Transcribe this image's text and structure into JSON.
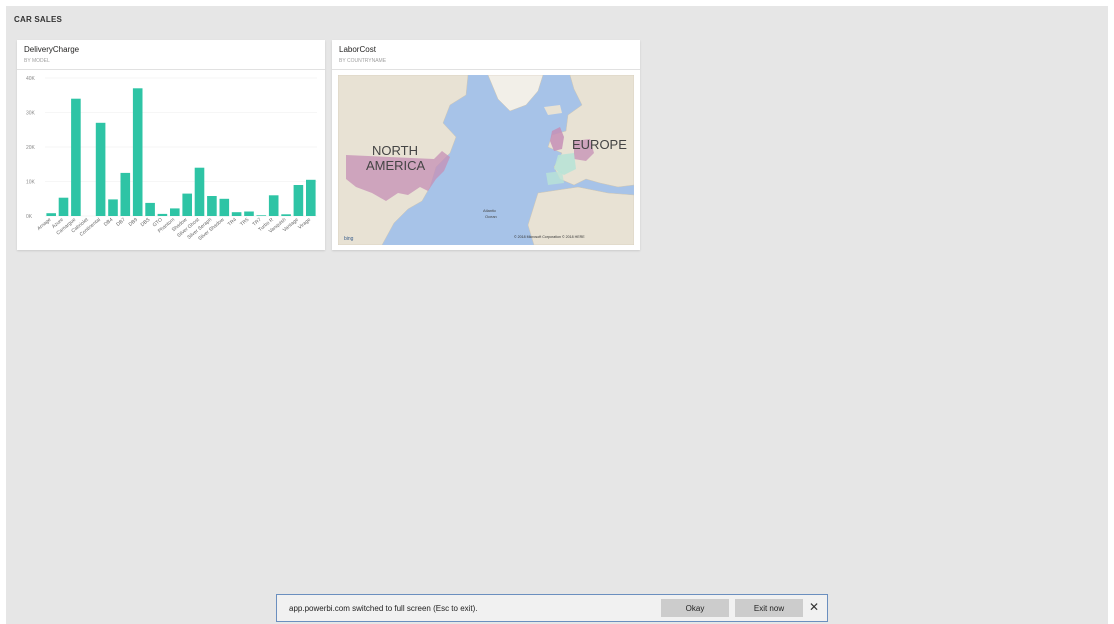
{
  "dashboard": {
    "title": "CAR SALES"
  },
  "tiles": [
    {
      "title": "DeliveryCharge",
      "subtitle": "BY MODEL"
    },
    {
      "title": "LaborCost",
      "subtitle": "BY COUNTRYNAME"
    }
  ],
  "chart_data": {
    "type": "bar",
    "title": "DeliveryCharge",
    "subtitle": "BY MODEL",
    "color": "#2ec4a5",
    "ylim": [
      0,
      40000
    ],
    "yticks": [
      "0K",
      "10K",
      "20K",
      "30K",
      "40K"
    ],
    "grid": true,
    "categories": [
      "Arnage",
      "Azure",
      "Camargue",
      "Cabriolet",
      "Continental",
      "DB4",
      "DB7",
      "DB9",
      "DBS",
      "GTO",
      "Phantom",
      "Shadow",
      "Silver Ghost",
      "Silver Seraph",
      "Silver Shadow",
      "TR4",
      "TR5",
      "TR7",
      "Turbo R",
      "Vanquish",
      "Vantage",
      "Virage"
    ],
    "values": [
      800,
      5300,
      34000,
      0,
      27000,
      4800,
      12500,
      37000,
      3800,
      600,
      2200,
      6500,
      14000,
      5800,
      5000,
      1100,
      1300,
      200,
      6000,
      500,
      9000,
      10500
    ]
  },
  "map": {
    "labels": [
      "NORTH",
      "AMERICA",
      "EUROPE",
      "Atlantic",
      "Ocean"
    ],
    "attribution": "© 2018 Microsoft Corporation   © 2018 HERE",
    "provider": "bing",
    "highlight_color": "#c58fb6"
  },
  "fullscreen_bar": {
    "message": "app.powerbi.com switched to full screen (Esc to exit).",
    "okay": "Okay",
    "exit": "Exit now",
    "close": "✕"
  }
}
